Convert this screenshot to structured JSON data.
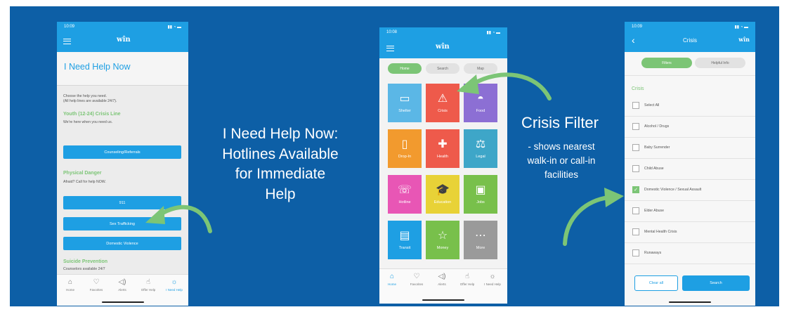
{
  "colors": {
    "background": "#0d5fa6",
    "app_blue": "#1e9fe3",
    "accent_green": "#7cc576"
  },
  "left_caption": {
    "lines": [
      "I Need Help Now:",
      "Hotlines Available",
      "for Immediate",
      "Help"
    ]
  },
  "right_caption": {
    "title": "Crisis Filter",
    "lines": [
      "- shows nearest",
      "walk-in or call-in",
      "facilities"
    ]
  },
  "phone1": {
    "time": "10:09",
    "logo": "wîn",
    "page_title": "I Need Help Now",
    "intro_lines": [
      "Choose the help you need.",
      "(All help lines are available 24/7)."
    ],
    "section_youth": {
      "title": "Youth (12-24) Crisis Line",
      "text": "We're here when you need us.",
      "button": "Counseling/Referrals"
    },
    "section_danger": {
      "title": "Physical Danger",
      "text": "Afraid? Call for help NOW.",
      "buttons": [
        "911",
        "Sex Trafficking",
        "Domestic Violence"
      ]
    },
    "section_suicide": {
      "title": "Suicide Prevention",
      "text": "Counselors available 24/7"
    },
    "tabs": [
      {
        "icon": "home-icon",
        "label": "Home"
      },
      {
        "icon": "heart-icon",
        "label": "Favorites"
      },
      {
        "icon": "megaphone-icon",
        "label": "Alerts"
      },
      {
        "icon": "hand-icon",
        "label": "Offer Help"
      },
      {
        "icon": "help-now-icon",
        "label": "I Need Help"
      }
    ]
  },
  "phone2": {
    "time": "10:08",
    "logo": "wîn",
    "segments": [
      "Home",
      "Search",
      "Map"
    ],
    "tiles": [
      {
        "label": "Shelter",
        "icon": "bed-icon",
        "color": "#5bb7e6"
      },
      {
        "label": "Crisis",
        "icon": "warning-icon",
        "color": "#ee5a4b"
      },
      {
        "label": "Food",
        "icon": "food-icon",
        "color": "#8c6fd4"
      },
      {
        "label": "Drop-In",
        "icon": "door-icon",
        "color": "#f29a2e"
      },
      {
        "label": "Health",
        "icon": "medical-icon",
        "color": "#ee5a4b"
      },
      {
        "label": "Legal",
        "icon": "scales-icon",
        "color": "#3ea6c8"
      },
      {
        "label": "Hotline",
        "icon": "phone-icon",
        "color": "#e856b5"
      },
      {
        "label": "Education",
        "icon": "graduation-icon",
        "color": "#e8d237"
      },
      {
        "label": "Jobs",
        "icon": "briefcase-icon",
        "color": "#78c04b"
      },
      {
        "label": "Transit",
        "icon": "bus-icon",
        "color": "#1e9fe3"
      },
      {
        "label": "Money",
        "icon": "star-icon",
        "color": "#78c04b"
      },
      {
        "label": "More",
        "icon": "more-icon",
        "color": "#9a9a9a"
      }
    ],
    "tabs": [
      "Home",
      "Favorites",
      "Alerts",
      "Offer Help",
      "I Need Help"
    ]
  },
  "phone3": {
    "time": "10:09",
    "title": "Crisis",
    "logo": "wîn",
    "segments": [
      "Filters",
      "Helpful Info"
    ],
    "section": "Crisis",
    "options": [
      {
        "label": "Select All",
        "checked": false
      },
      {
        "label": "Alcohol / Drugs",
        "checked": false
      },
      {
        "label": "Baby Surrender",
        "checked": false
      },
      {
        "label": "Child Abuse",
        "checked": false
      },
      {
        "label": "Domestic Violence / Sexual Assault",
        "checked": true
      },
      {
        "label": "Elder Abuse",
        "checked": false
      },
      {
        "label": "Mental Health Crisis",
        "checked": false
      },
      {
        "label": "Runaways",
        "checked": false
      }
    ],
    "clear_label": "Clear all",
    "search_label": "Search"
  }
}
